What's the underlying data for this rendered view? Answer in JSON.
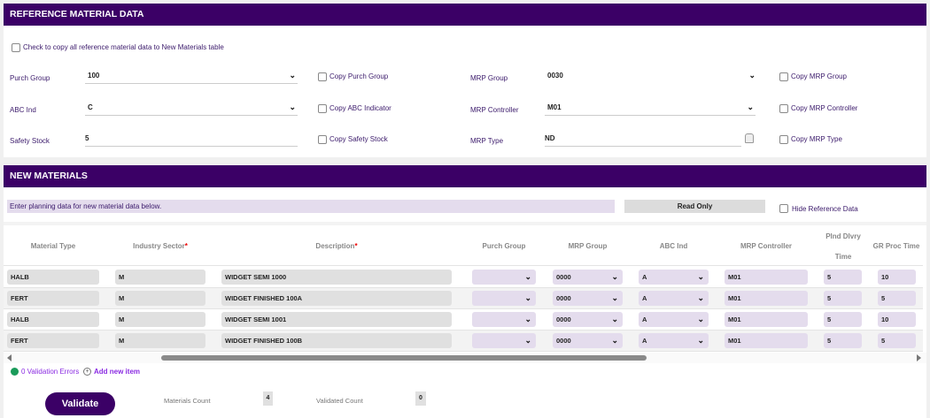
{
  "reference": {
    "title": "REFERENCE MATERIAL DATA",
    "copy_all_label": "Check to copy all reference material data to New Materials table",
    "purch_group": {
      "label": "Purch Group",
      "value": "100",
      "copy_label": "Copy Purch Group"
    },
    "abc_ind": {
      "label": "ABC Ind",
      "value": "C",
      "copy_label": "Copy ABC Indicator"
    },
    "safety_stock": {
      "label": "Safety Stock",
      "value": "5",
      "copy_label": "Copy Safety Stock"
    },
    "mrp_group": {
      "label": "MRP Group",
      "value": "0030",
      "copy_label": "Copy MRP Group"
    },
    "mrp_controller": {
      "label": "MRP Controller",
      "value": "M01",
      "copy_label": "Copy MRP Controller"
    },
    "mrp_type": {
      "label": "MRP Type",
      "value": "ND",
      "copy_label": "Copy MRP Type"
    }
  },
  "new_materials": {
    "title": "NEW MATERIALS",
    "instruction": "Enter planning data for new material data below.",
    "read_only_label": "Read Only",
    "hide_reference_label": "Hide Reference Data",
    "columns": [
      "Material Type",
      "Industry Sector",
      "Description",
      "Purch Group",
      "MRP Group",
      "ABC Ind",
      "MRP Controller",
      "Plnd Dlvry",
      "Time",
      "GR Proc Time"
    ],
    "required_mark": "*",
    "rows": [
      [
        "HALB",
        "M",
        "WIDGET SEMI 1000",
        "",
        "0000",
        "A",
        "M01",
        "5",
        "10"
      ],
      [
        "FERT",
        "M",
        "WIDGET FINISHED 100A",
        "",
        "0000",
        "A",
        "M01",
        "5",
        "5"
      ],
      [
        "HALB",
        "M",
        "WIDGET SEMI 1001",
        "",
        "0000",
        "A",
        "M01",
        "5",
        "10"
      ],
      [
        "FERT",
        "M",
        "WIDGET FINISHED 100B",
        "",
        "0000",
        "A",
        "M01",
        "5",
        "5"
      ]
    ],
    "validation_errors": "0 Validation Errors",
    "add_item": "Add new item",
    "validate_label": "Validate",
    "materials_count_label": "Materials Count",
    "materials_count": "4",
    "validated_count_label": "Validated Count",
    "validated_count": "0"
  },
  "colors": {
    "brand": "#3b0066",
    "success": "#1a9b5a",
    "link": "#8a2be2"
  }
}
